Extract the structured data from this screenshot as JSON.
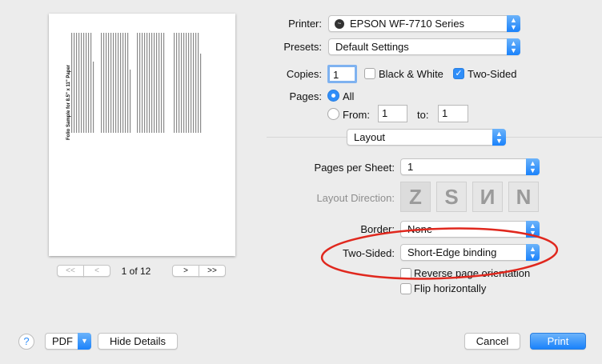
{
  "preview": {
    "page_title": "Folio Sample for 8.5\" x 11\" Paper",
    "page_indicator": "1 of 12",
    "first_label": "<<",
    "prev_label": "<",
    "next_label": ">",
    "last_label": ">>"
  },
  "printer": {
    "label": "Printer:",
    "value": "EPSON WF-7710 Series"
  },
  "presets": {
    "label": "Presets:",
    "value": "Default Settings"
  },
  "copies": {
    "label": "Copies:",
    "value": "1",
    "bw_label": "Black & White",
    "bw_checked": false,
    "two_sided_label": "Two-Sided",
    "two_sided_checked": true
  },
  "pages": {
    "label": "Pages:",
    "all_label": "All",
    "from_label": "From:",
    "from_value": "1",
    "to_label": "to:",
    "to_value": "1",
    "selected": "All"
  },
  "section": {
    "value": "Layout"
  },
  "layout": {
    "pages_per_sheet_label": "Pages per Sheet:",
    "pages_per_sheet_value": "1",
    "direction_label": "Layout Direction:",
    "directions": [
      "Z",
      "S",
      "N-reversed",
      "N"
    ],
    "border_label": "Border:",
    "border_value": "None",
    "two_sided_label": "Two-Sided:",
    "two_sided_value": "Short-Edge binding",
    "reverse_label": "Reverse page orientation",
    "reverse_checked": false,
    "flip_label": "Flip horizontally",
    "flip_checked": false
  },
  "annotation": {
    "color": "#e0281e",
    "shape": "ellipse around Two-Sided setting"
  },
  "footer": {
    "help_label": "?",
    "pdf_label": "PDF",
    "hide_details_label": "Hide Details",
    "cancel_label": "Cancel",
    "print_label": "Print"
  },
  "colors": {
    "accent": "#1a82fb"
  }
}
